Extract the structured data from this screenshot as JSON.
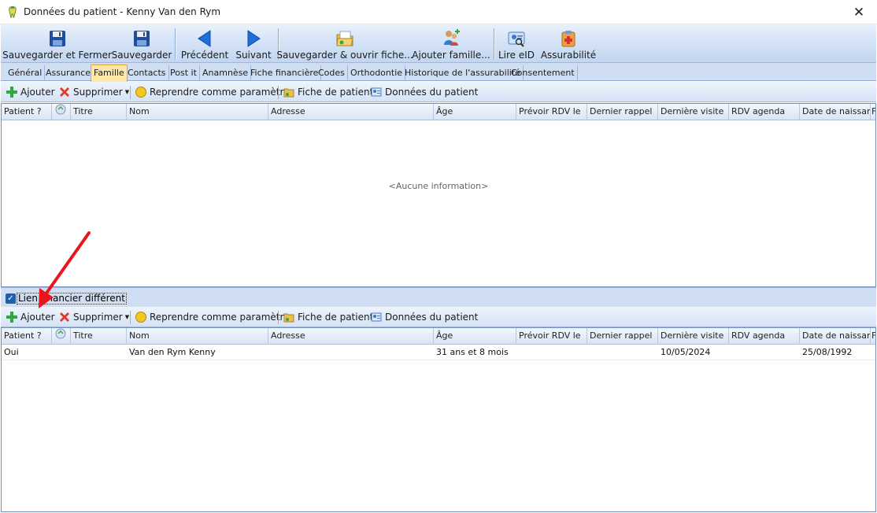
{
  "window": {
    "title": "Données du patient - Kenny Van den Rym",
    "close_glyph": "✕"
  },
  "ribbon": {
    "buttons": [
      {
        "label": "Sauvegarder et Fermer",
        "icon": "floppy-disk-icon"
      },
      {
        "label": "Sauvegarder",
        "icon": "floppy-disk-icon"
      },
      {
        "label": "Précédent",
        "icon": "arrow-left-icon"
      },
      {
        "label": "Suivant",
        "icon": "arrow-right-icon"
      },
      {
        "label": "Sauvegarder & ouvrir fiche...",
        "icon": "folder-icon"
      },
      {
        "label": "Ajouter famille...",
        "icon": "family-add-icon"
      },
      {
        "label": "Lire eID",
        "icon": "eid-card-icon"
      },
      {
        "label": "Assurabilité",
        "icon": "insurance-icon"
      }
    ]
  },
  "tabs": [
    "Général",
    "Assurance",
    "Famille",
    "Contacts",
    "Post it",
    "Anamnèse",
    "Fiche financière",
    "Codes",
    "Orthodontie",
    "Historique de l'assurabilité",
    "Consentement"
  ],
  "active_tab": "Famille",
  "toolbar": {
    "add": "Ajouter",
    "delete": "Supprimer",
    "reuse": "Reprendre comme paramètre",
    "patient_file": "Fiche de patient",
    "patient_data": "Données du patient"
  },
  "columns": [
    "Patient ?",
    "",
    "Titre",
    "Nom",
    "Adresse",
    "Âge",
    "Prévoir RDV le",
    "Dernier rappel",
    "Dernière visite",
    "RDV agenda",
    "Date de naissance",
    "F"
  ],
  "top_grid": {
    "empty_text": "<Aucune information>"
  },
  "checkbox": {
    "label": "Lien financier différent",
    "checked": true
  },
  "bottom_grid": {
    "rows": [
      {
        "patient": "Oui",
        "titre": "",
        "nom": "Van den Rym Kenny",
        "adresse": "",
        "age": "31 ans et 8 mois",
        "prevoir": "",
        "rappel": "",
        "visite": "10/05/2024",
        "rdv": "",
        "naissance": "25/08/1992"
      }
    ]
  },
  "colors": {
    "accent": "#1e6fd9",
    "active_tab": "#fde8a8",
    "arrow": "#e8151b"
  }
}
